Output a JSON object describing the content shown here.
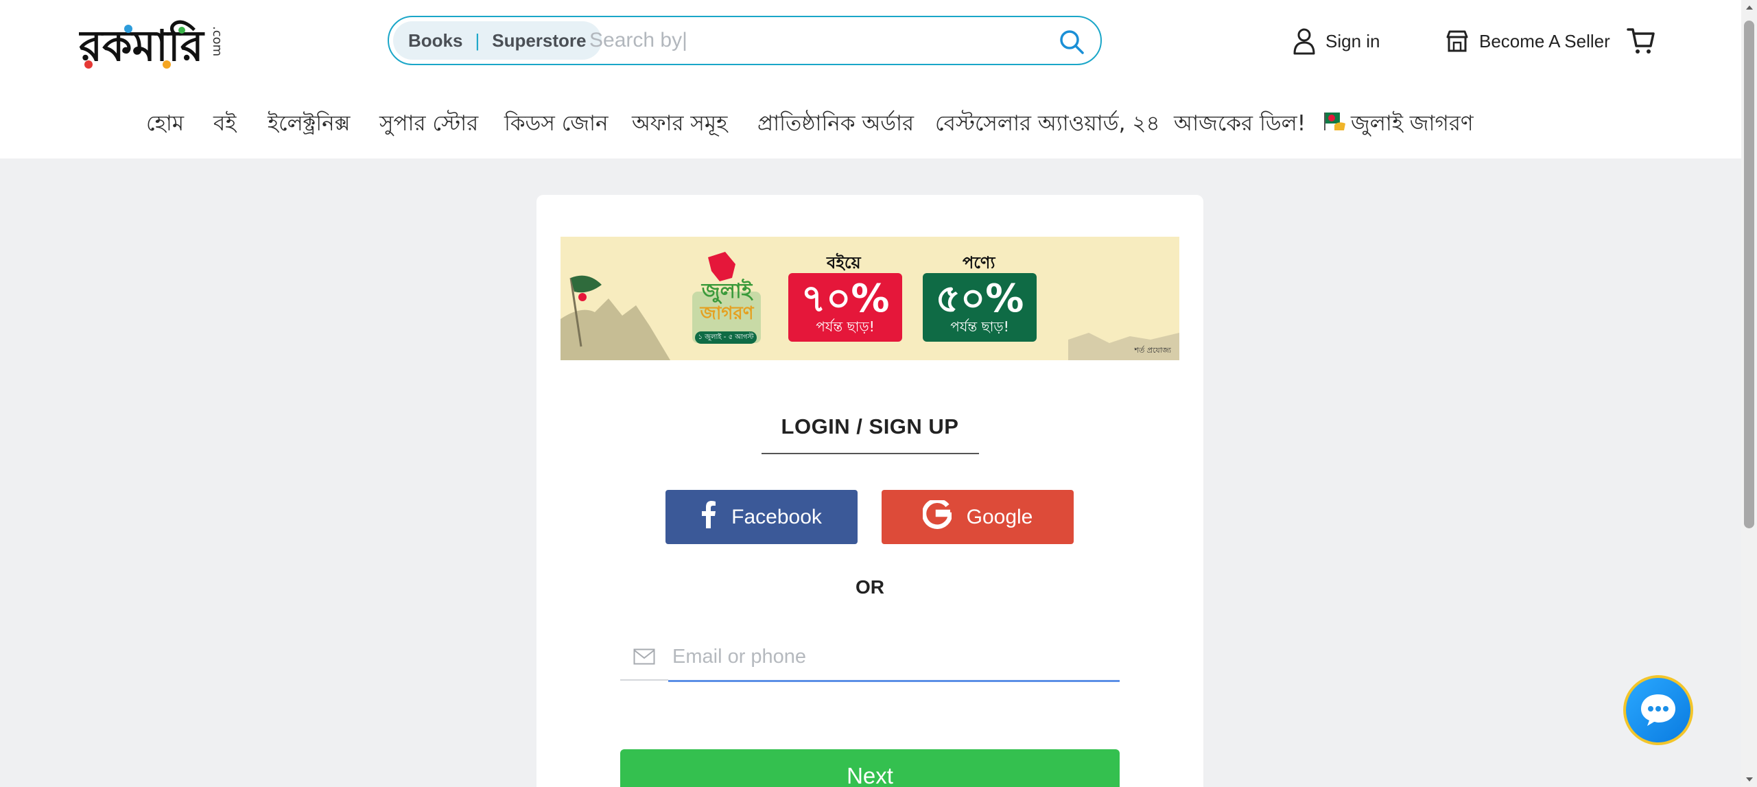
{
  "header": {
    "logo_text": "রকমারি",
    "logo_suffix": ".com",
    "search": {
      "pill_books": "Books",
      "pill_separator": "|",
      "pill_superstore": "Superstore",
      "placeholder": "Search by|",
      "value": ""
    },
    "sign_in_label": "Sign in",
    "become_seller_label": "Become A Seller"
  },
  "nav": {
    "items": [
      {
        "label": "হোম"
      },
      {
        "label": "বই"
      },
      {
        "label": "ইলেক্ট্রনিক্স"
      },
      {
        "label": "সুপার স্টোর"
      },
      {
        "label": "কিডস জোন"
      },
      {
        "label": "অফার সমূহ"
      },
      {
        "label": "প্রাতিষ্ঠানিক অর্ডার"
      },
      {
        "label": "বেস্টসেলার অ্যাওয়ার্ড, ২৪"
      },
      {
        "label": "আজকের ডিল!"
      },
      {
        "label": "জুলাই জাগরণ"
      }
    ]
  },
  "banner": {
    "campaign_line1": "জুলাই",
    "campaign_line2": "জাগরণ",
    "campaign_dates": "১ জুলাই - ৫ আগস্ট",
    "books_label": "বইয়ে",
    "books_discount": "৭০%",
    "books_upto": "পর্যন্ত ছাড়!",
    "products_label": "পণ্যে",
    "products_discount": "৫০%",
    "products_upto": "পর্যন্ত ছাড়!",
    "terms": "শর্ত প্রযোজ্য"
  },
  "login": {
    "title": "LOGIN / SIGN UP",
    "facebook_label": "Facebook",
    "google_label": "Google",
    "or_label": "OR",
    "email_placeholder": "Email or phone",
    "email_value": "",
    "next_label": "Next"
  },
  "colors": {
    "search_border": "#1aa6c8",
    "facebook": "#3b5998",
    "google": "#dd4b39",
    "next": "#34c04f",
    "banner_red": "#e5173a",
    "banner_green": "#0f6b45",
    "chat_ring": "#f2c52b"
  }
}
